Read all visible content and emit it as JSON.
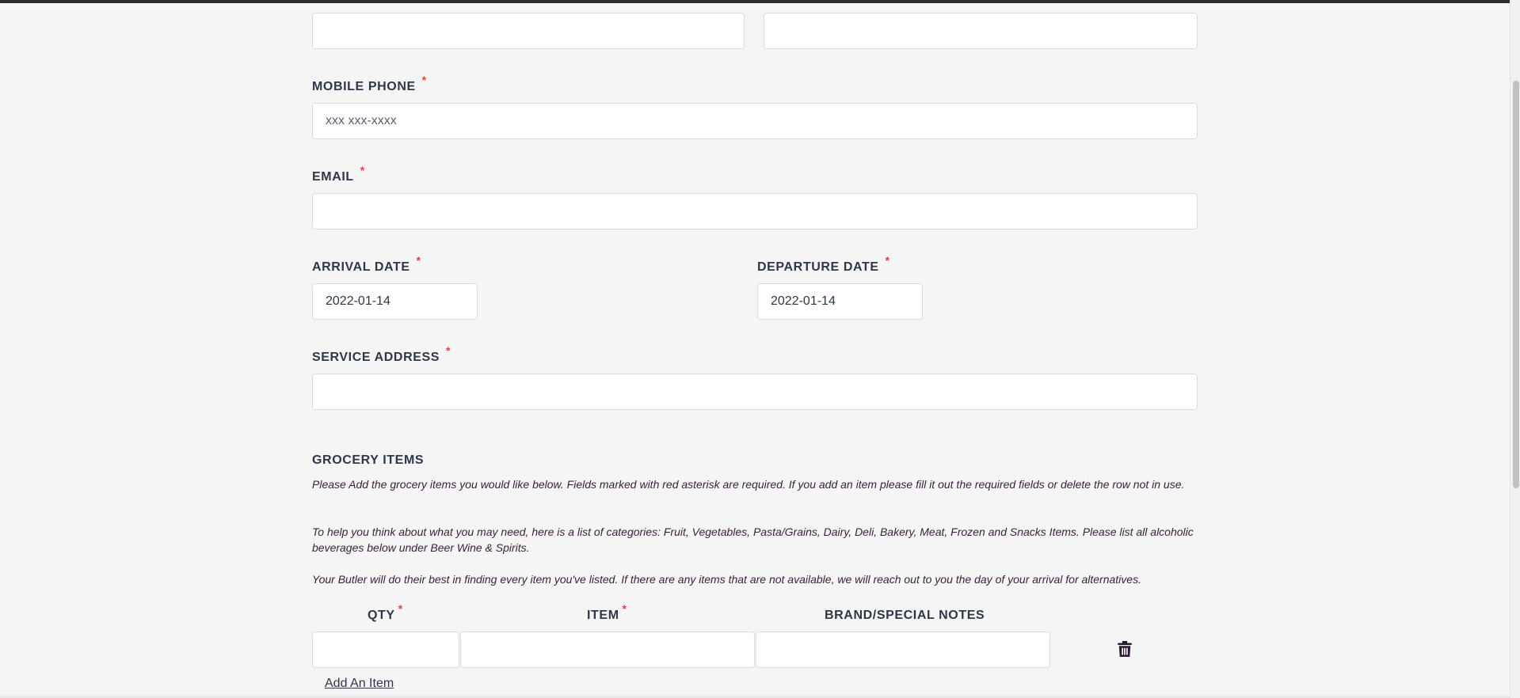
{
  "fields": {
    "top_left": {
      "value": ""
    },
    "top_right": {
      "value": ""
    },
    "mobile_phone": {
      "label": "MOBILE PHONE",
      "required_mark": "*",
      "placeholder": "xxx xxx-xxxx",
      "value": ""
    },
    "email": {
      "label": "EMAIL",
      "required_mark": "*",
      "value": ""
    },
    "arrival_date": {
      "label": "ARRIVAL DATE",
      "required_mark": "*",
      "value": "2022-01-14"
    },
    "departure_date": {
      "label": "DEPARTURE DATE",
      "required_mark": "*",
      "value": "2022-01-14"
    },
    "service_address": {
      "label": "SERVICE ADDRESS",
      "required_mark": "*",
      "value": ""
    }
  },
  "grocery": {
    "title": "GROCERY ITEMS",
    "paragraphs": [
      "Please Add the grocery items you would like below. Fields marked with red asterisk are required. If you add an item please fill it out the required fields or delete the row not in use.",
      "To help you think about what you may need, here is a list of categories: Fruit, Vegetables, Pasta/Grains, Dairy, Deli, Bakery, Meat, Frozen and Snacks Items. Please list all alcoholic beverages below under Beer Wine & Spirits.",
      "Your Butler will do their best in finding every item you've listed. If there are any items that are not available, we will reach out to you the day of your arrival for alternatives."
    ],
    "columns": {
      "qty": "QTY",
      "qty_required": "*",
      "item": "ITEM",
      "item_required": "*",
      "notes": "BRAND/SPECIAL NOTES"
    },
    "row": {
      "qty": "",
      "item": "",
      "notes": ""
    },
    "delete_icon": "trash-icon",
    "add_item_label": "Add An Item"
  },
  "colors": {
    "background": "#f5f5f5",
    "text": "#2d3748",
    "required": "#e53e3e",
    "italic_text": "#3a1f3a"
  }
}
